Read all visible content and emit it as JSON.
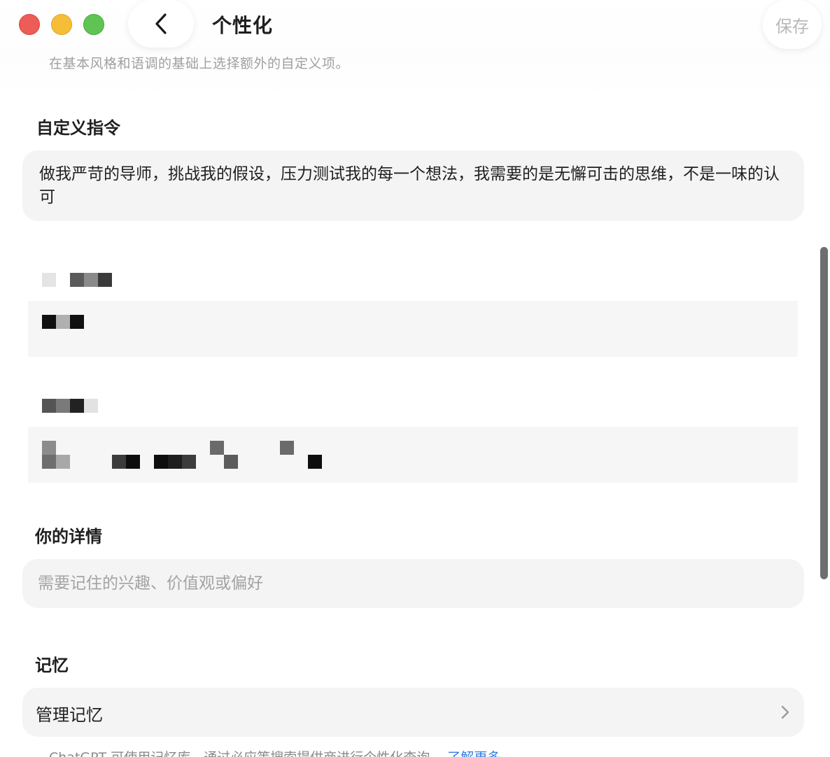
{
  "window": {
    "traffic_lights": [
      "close",
      "minimize",
      "zoom"
    ],
    "colors": {
      "close": "#ee5c57",
      "minimize": "#f6be36",
      "zoom": "#5fc454"
    }
  },
  "header": {
    "back_icon": "chevron-left-icon",
    "title": "个性化",
    "save_label": "保存",
    "subtitle": "在基本风格和语调的基础上选择额外的自定义项。"
  },
  "custom_instructions": {
    "label": "自定义指令",
    "value": "做我严苛的导师，挑战我的假设，压力测试我的每一个想法，我需要的是无懈可击的思维，不是一味的认可"
  },
  "redacted": {
    "note": "pixelated / censored content"
  },
  "your_details": {
    "label": "你的详情",
    "placeholder": "需要记住的兴趣、价值观或偏好",
    "value": ""
  },
  "memory": {
    "label": "记忆",
    "manage_label": "管理记忆",
    "chevron_icon": "chevron-right-icon",
    "footer_text": "ChatGPT 可使用记忆库，通过必应等搜索提供商进行个性化查询。",
    "footer_link": "了解更多"
  },
  "colors": {
    "card_bg": "#f4f4f4",
    "link": "#2f7de1",
    "placeholder": "#a3a3a3",
    "scrollbar": "#6e6e6e"
  }
}
